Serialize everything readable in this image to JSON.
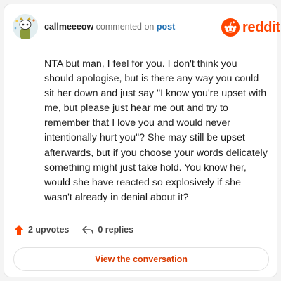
{
  "comment": {
    "username": "callmeeeow",
    "action_text": "commented on",
    "post_link": "post",
    "body": "NTA but man, I feel for you. I don't think you should apologise, but is there any way you could sit her down and just say \"I know you're upset with me, but please just hear me out and try to remember that I love you and would never intentionally hurt you\"? She may still be upset afterwards, but if you choose your words delicately something might just take hold. You know her, would she have reacted so explosively if she wasn't already in denial about it?"
  },
  "brand": {
    "name": "reddit",
    "color": "#ff4500"
  },
  "footer": {
    "upvotes": "2 upvotes",
    "replies": "0 replies",
    "upvote_icon": "upvote-arrow-icon",
    "reply_icon": "reply-arrow-icon"
  },
  "cta": {
    "label": "View the conversation",
    "color": "#d93a00"
  }
}
